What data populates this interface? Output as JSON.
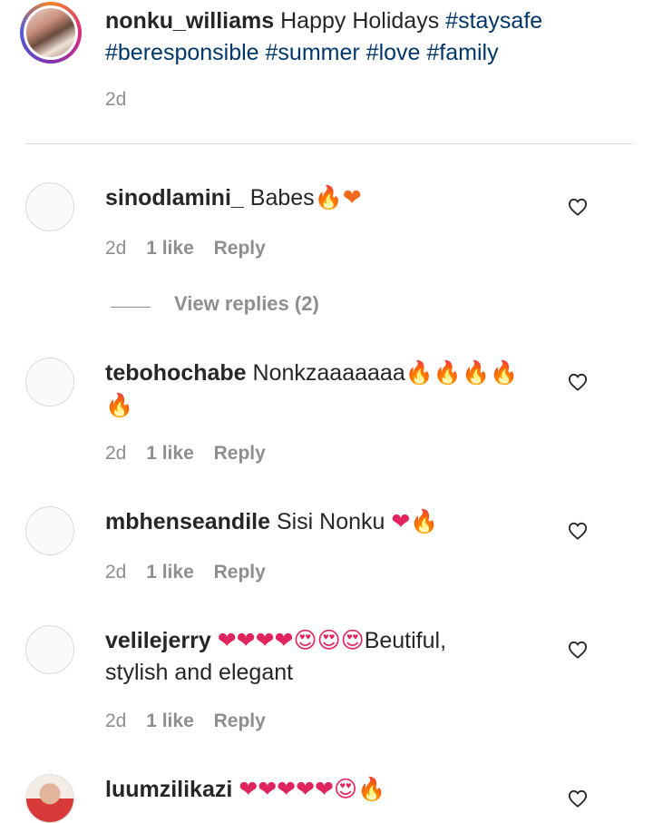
{
  "caption": {
    "username": "nonku_williams",
    "text": "Happy Holidays",
    "hashtags": [
      "#staysafe",
      "#beresponsible",
      "#summer",
      "#love",
      "#family"
    ],
    "time": "2d"
  },
  "comments": [
    {
      "username": "sinodlamini_",
      "text": "Babes",
      "emojis": "🔥❤",
      "time": "2d",
      "likes": "1 like",
      "reply": "Reply",
      "view_replies": "View replies (2)"
    },
    {
      "username": "tebohochabe",
      "text": "Nonkzaaaaaaa",
      "emojis": "🔥🔥🔥🔥",
      "emojis_line2": "🔥",
      "time": "2d",
      "likes": "1 like",
      "reply": "Reply"
    },
    {
      "username": "mbhenseandile",
      "text": "Sisi Nonku",
      "emojis": "❤🔥",
      "time": "2d",
      "likes": "1 like",
      "reply": "Reply"
    },
    {
      "username": "velilejerry",
      "emojis": "❤❤❤❤😍😍😍",
      "text": "Beutiful,",
      "text_line2": "stylish and elegant",
      "time": "2d",
      "likes": "1 like",
      "reply": "Reply"
    },
    {
      "username": "luumzilikazi",
      "emojis": "❤❤❤❤❤😍🔥"
    }
  ],
  "icons": {
    "heart": "heart-outline-icon",
    "avatar": "user-avatar"
  },
  "colors": {
    "text": "#262626",
    "hashtag": "#00376b",
    "secondary": "#8e8e8e",
    "divider": "#dbdbdb"
  }
}
